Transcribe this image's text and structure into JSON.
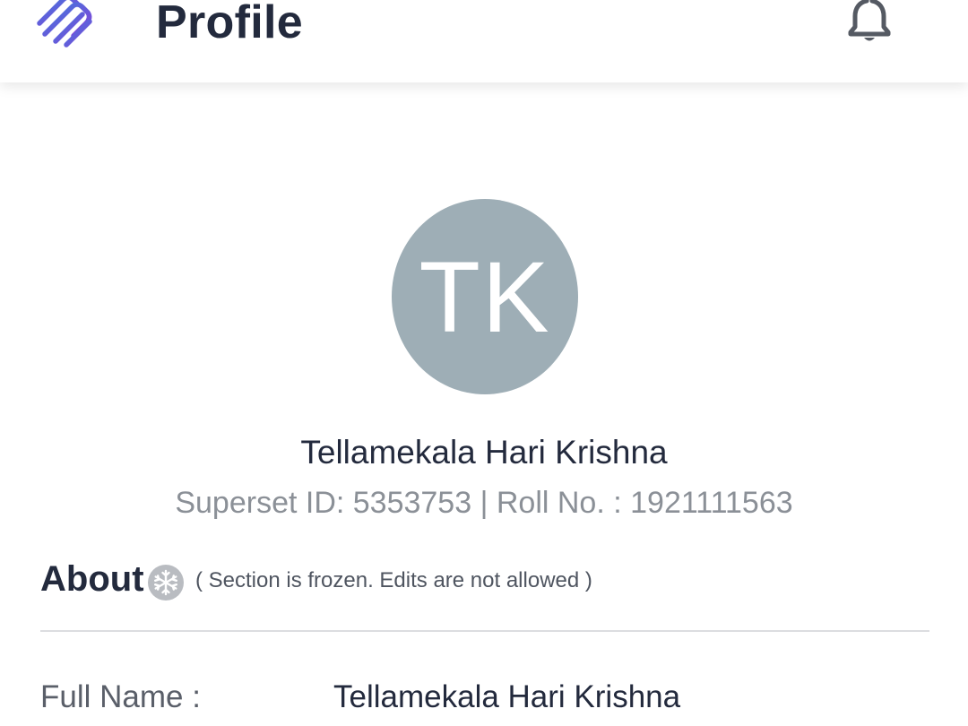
{
  "header": {
    "title": "Profile",
    "logo_icon": "brand-logo-icon",
    "notification_icon": "bell-icon"
  },
  "profile": {
    "avatar_initials": "TK",
    "avatar_color": "#9eaeb6",
    "name": "Tellamekala Hari Krishna",
    "ids_line": "Superset ID: 5353753 | Roll No. : 1921111563"
  },
  "about": {
    "heading": "About",
    "status_icon": "snowflake-icon",
    "frozen_note": "( Section is frozen. Edits are not allowed )",
    "fields": [
      {
        "label": "Full Name :",
        "value": "Tellamekala Hari Krishna"
      }
    ]
  },
  "colors": {
    "text_primary": "#232a3d",
    "text_secondary": "#8b9097",
    "logo_gradient_start": "#3b7ddd",
    "logo_gradient_end": "#8a3fd8"
  }
}
